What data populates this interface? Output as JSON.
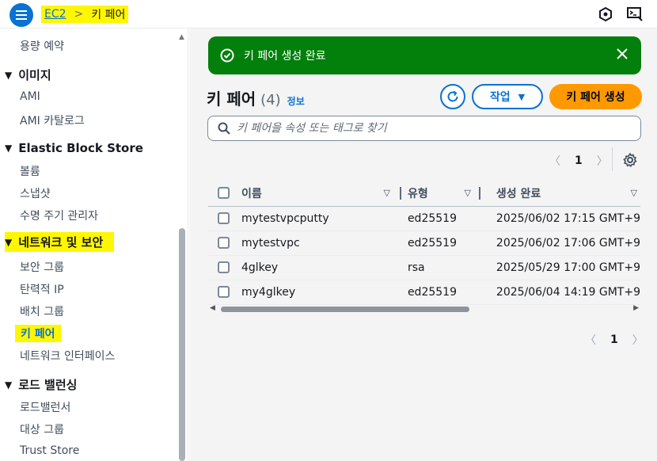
{
  "breadcrumb": {
    "root": "EC2",
    "separator": ">",
    "current": "키 페어"
  },
  "sidebar": {
    "items": [
      {
        "type": "item",
        "label": "용량 예약"
      },
      {
        "type": "section",
        "label": "이미지"
      },
      {
        "type": "item",
        "label": "AMI"
      },
      {
        "type": "item",
        "label": "AMI 카탈로그"
      },
      {
        "type": "section",
        "label": "Elastic Block Store"
      },
      {
        "type": "item",
        "label": "볼륨"
      },
      {
        "type": "item",
        "label": "스냅샷"
      },
      {
        "type": "item",
        "label": "수명 주기 관리자"
      },
      {
        "type": "section",
        "label": "네트워크 및 보안"
      },
      {
        "type": "item",
        "label": "보안 그룹"
      },
      {
        "type": "item",
        "label": "탄력적 IP"
      },
      {
        "type": "item",
        "label": "배치 그룹"
      },
      {
        "type": "item",
        "label": "키 페어"
      },
      {
        "type": "item",
        "label": "네트워크 인터페이스"
      },
      {
        "type": "section",
        "label": "로드 밸런싱"
      },
      {
        "type": "item",
        "label": "로드밸런서"
      },
      {
        "type": "item",
        "label": "대상 그룹"
      },
      {
        "type": "item",
        "label": "Trust Store"
      }
    ],
    "caret": "▼"
  },
  "flash": {
    "message": "키 페어 생성 완료",
    "close": "✕"
  },
  "panel": {
    "title": "키 페어",
    "count": "(4)",
    "info": "정보",
    "actions_label": "작업",
    "actions_caret": "▼",
    "create_label": "키 페어 생성"
  },
  "search": {
    "placeholder": "키 페어을 속성 또는 태그로 찾기",
    "value": ""
  },
  "pagination": {
    "page": "1",
    "prev": "〈",
    "next": "〉"
  },
  "table": {
    "columns": [
      "이름",
      "유형",
      "생성 완료"
    ],
    "sort_icon": "▽",
    "rows": [
      {
        "name": "mytestvpcputty",
        "type": "ed25519",
        "created": "2025/06/02 17:15 GMT+9"
      },
      {
        "name": "mytestvpc",
        "type": "ed25519",
        "created": "2025/06/02 17:06 GMT+9"
      },
      {
        "name": "4glkey",
        "type": "rsa",
        "created": "2025/05/29 17:00 GMT+9"
      },
      {
        "name": "my4glkey",
        "type": "ed25519",
        "created": "2025/06/04 14:19 GMT+9"
      }
    ]
  },
  "colors": {
    "accent": "#0972d3",
    "success": "#037f0c",
    "primary_button": "#ff9900",
    "highlight": "#fff700"
  },
  "icons": {
    "menu": "hamburger-icon",
    "notifications": "notification-icon",
    "cloudshell": "cloudshell-icon",
    "refresh": "refresh-icon",
    "settings": "gear-icon",
    "search": "search-icon",
    "success": "check-circle-icon"
  }
}
